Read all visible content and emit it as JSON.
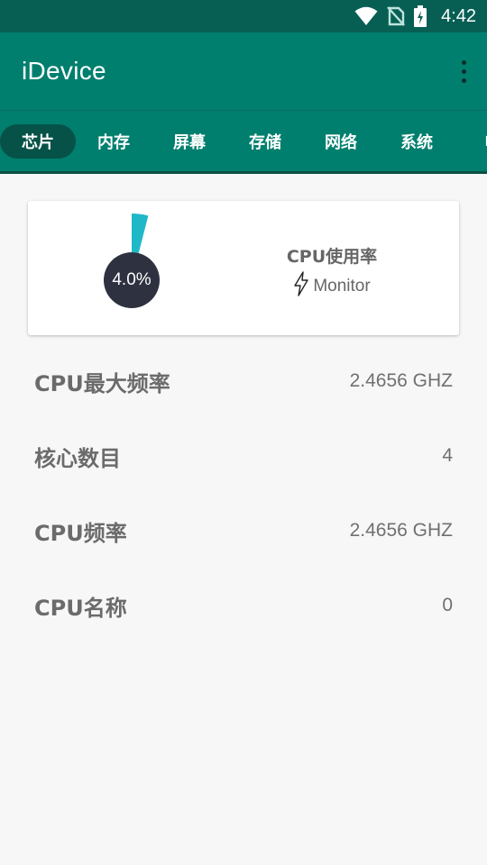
{
  "status_bar": {
    "time": "4:42",
    "icons": [
      "wifi-icon",
      "no-sim-icon",
      "battery-charging-icon"
    ]
  },
  "app_bar": {
    "title": "iDevice",
    "menu_icon": "more-vert-icon"
  },
  "tabs": [
    {
      "label": "芯片",
      "active": true
    },
    {
      "label": "内存",
      "active": false
    },
    {
      "label": "屏幕",
      "active": false
    },
    {
      "label": "存储",
      "active": false
    },
    {
      "label": "网络",
      "active": false
    },
    {
      "label": "系统",
      "active": false
    },
    {
      "label": "电",
      "active": false
    }
  ],
  "cpu_card": {
    "usage_value": "4.0%",
    "usage_fraction": 0.04,
    "title": "CPU使用率",
    "monitor_label": "Monitor",
    "monitor_icon": "lightning-icon",
    "gauge_color": "#1fb8c9",
    "center_color": "#2e3140"
  },
  "info": [
    {
      "label": "CPU最大频率",
      "value": "2.4656 GHZ"
    },
    {
      "label": "核心数目",
      "value": "4"
    },
    {
      "label": "CPU频率",
      "value": "2.4656 GHZ"
    },
    {
      "label": "CPU名称",
      "value": "0"
    }
  ],
  "colors": {
    "status_bar": "#075f54",
    "app_bar": "#007f6e",
    "active_tab": "#075248",
    "background": "#f7f7f7"
  }
}
